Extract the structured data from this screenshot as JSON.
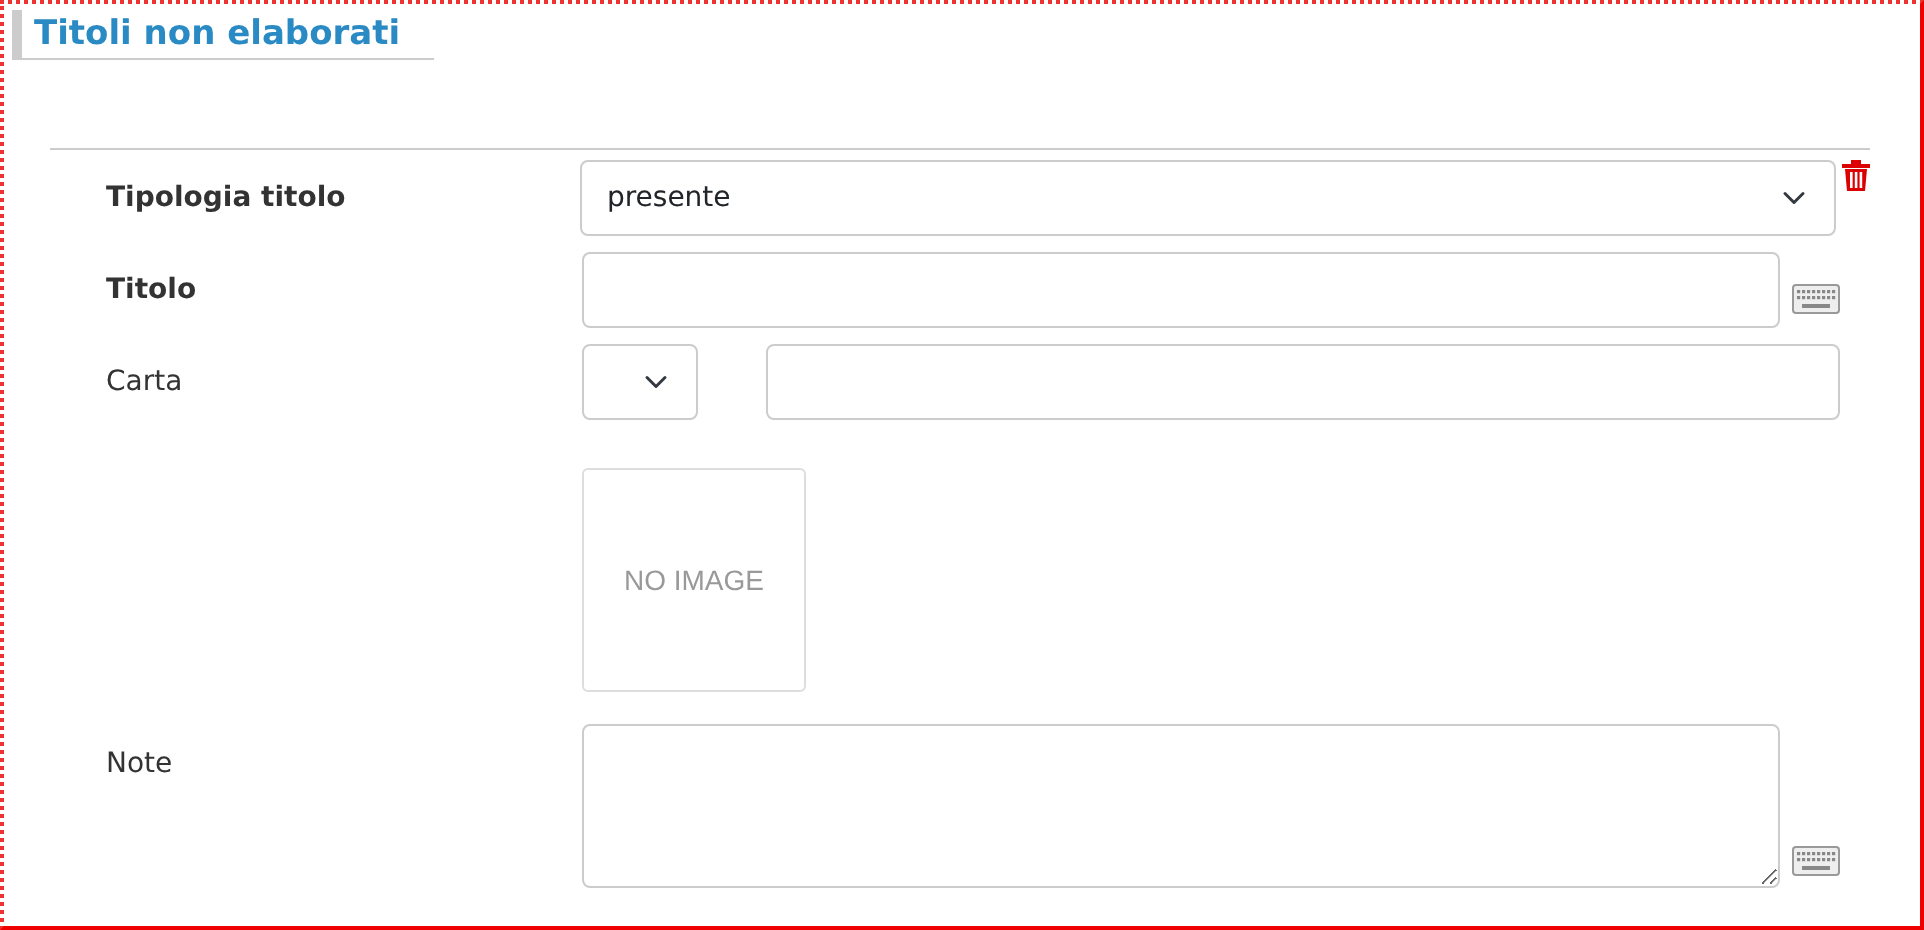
{
  "section": {
    "title": "Titoli non elaborati"
  },
  "fields": [
    {
      "kind": "select",
      "label": "Tipologia titolo",
      "required": true,
      "value": "presente",
      "delete": true
    },
    {
      "kind": "text",
      "label": "Titolo",
      "required": true,
      "keyboard": true
    },
    {
      "kind": "select_text",
      "label": "Carta",
      "required": false
    },
    {
      "kind": "image",
      "image_text": "NO IMAGE"
    },
    {
      "kind": "textarea",
      "label": "Note",
      "required": false,
      "keyboard": true
    }
  ]
}
